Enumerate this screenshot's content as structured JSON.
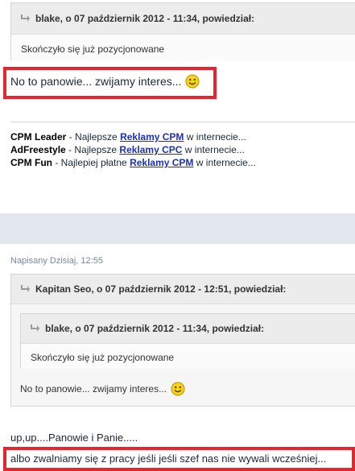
{
  "top_quote": {
    "header": "blake, o 07 październik 2012 - 11:34, powiedział:",
    "text": "Skończyło się już pozycjonowane"
  },
  "post1": {
    "text": "No to panowie... zwijamy interes..."
  },
  "signature": [
    {
      "name": "CPM Leader",
      "before": " - Najlepsze ",
      "link": "Reklamy CPM",
      "after": " w internecie..."
    },
    {
      "name": "AdFreestyle",
      "before": " - Najlepsze ",
      "link": "Reklamy CPC",
      "after": " w internecie..."
    },
    {
      "name": "CPM Fun",
      "before": " - Najlepiej płatne ",
      "link": "Reklamy CPM",
      "after": " w internecie..."
    }
  ],
  "post2": {
    "posted": "Napisany Dzisiaj, 12:55",
    "outer_quote_header": "Kapitan Seo, o 07 październik 2012 - 12:51, powiedział:",
    "inner_quote_header": "blake, o 07 październik 2012 - 11:34, powiedział:",
    "inner_quote_text": "Skończyło się już pozycjonowane",
    "outer_quote_text": "No to panowie... zwijamy interes...",
    "line1": "up,up....Panowie i Panie.....",
    "line2": "albo zwalniamy się z pracy jeśli jeśli szef nas nie wywali wcześniej..."
  },
  "colors": {
    "highlight_border": "#e8252f",
    "link": "#1e30b8",
    "separator_band": "#e3e8ef"
  }
}
